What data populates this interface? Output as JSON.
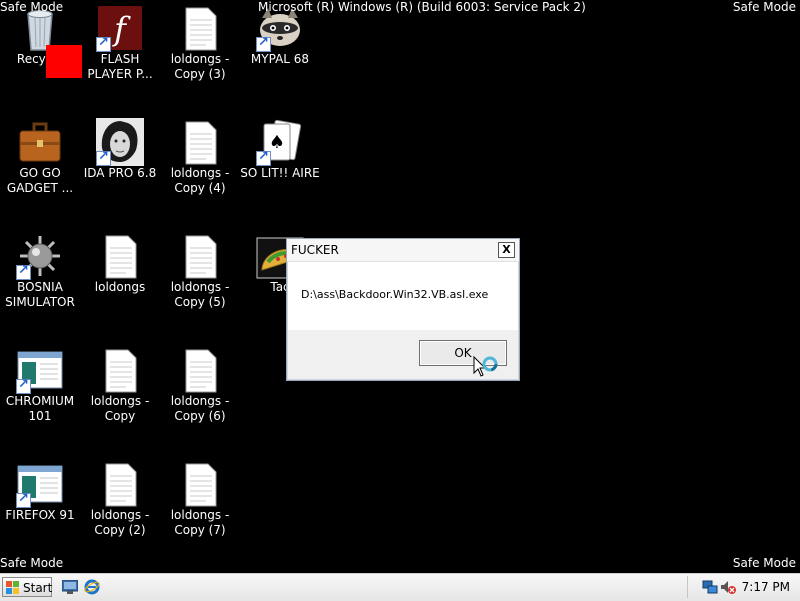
{
  "screen": {
    "safe_mode_tl": "Safe Mode",
    "safe_mode_tr": "Safe Mode",
    "safe_mode_bl": "Safe Mode",
    "safe_mode_br": "Safe Mode",
    "build_title": "Microsoft (R) Windows (R) (Build 6003: Service Pack 2)"
  },
  "desktop_icons": {
    "recycle": "Recycle",
    "flash": "FLASH PLAYER P...",
    "loldongs3": "loldongs - Copy (3)",
    "mypal": "MYPAL 68",
    "gogo": "GO GO GADGET ...",
    "ida": "IDA PRO 6.8",
    "loldongs4": "loldongs - Copy (4)",
    "solitaire": "SO LIT!! AIRE",
    "bosnia": "BOSNIA SIMULATOR",
    "loldongs": "loldongs",
    "loldongs5": "loldongs - Copy (5)",
    "taco": "Tac",
    "chromium": "CHROMIUM 101",
    "loldongscopy": "loldongs - Copy",
    "loldongs6": "loldongs - Copy (6)",
    "firefox": "FIREFOX 91",
    "loldongs2": "loldongs - Copy (2)",
    "loldongs7": "loldongs - Copy (7)"
  },
  "dialog": {
    "title": "FUCKER",
    "close_symbol": "X",
    "message": "D:\\ass\\Backdoor.Win32.VB.asl.exe",
    "ok_label": "OK"
  },
  "taskbar": {
    "start_label": "Start",
    "clock": "7:17 PM",
    "quick_launch": [
      "show-desktop-icon",
      "internet-explorer-icon"
    ],
    "tray_icons": [
      "network-icon",
      "volume-muted-icon"
    ]
  },
  "colors": {
    "desktop_bg": "#000000",
    "red_square": "#ff0000",
    "taskbar_bg": "#efefef"
  }
}
